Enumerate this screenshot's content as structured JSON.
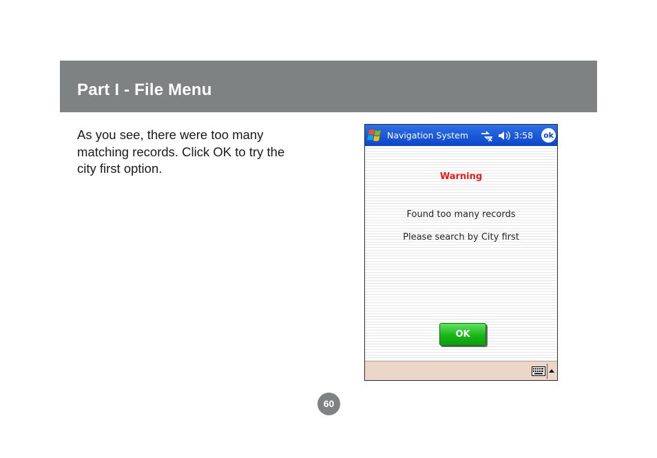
{
  "header": {
    "title": "Part I - File Menu"
  },
  "body": {
    "lines": [
      "As you see, there were too many",
      "matching records.  Click OK to try the",
      "city first option."
    ]
  },
  "device": {
    "titlebar": {
      "start_icon": "windows-flag-icon",
      "title": "Navigation System",
      "connectivity_icon": "connectivity-icon",
      "volume_icon": "speaker-icon",
      "time": "3:58",
      "ok_label": "ok"
    },
    "dialog": {
      "warning": "Warning",
      "message_1": "Found too many records",
      "message_2": "Please search by City first",
      "ok_button": "OK"
    },
    "menubar": {
      "keyboard_icon": "keyboard-icon",
      "sip_arrow_icon": "triangle-up-icon"
    }
  },
  "footer": {
    "page_number": "60"
  },
  "colors": {
    "header_band": "#7f8283",
    "titlebar": "#0b46c9",
    "warning": "#e81a1a",
    "ok_button": "#18b618",
    "menubar": "#ecd6c7"
  }
}
